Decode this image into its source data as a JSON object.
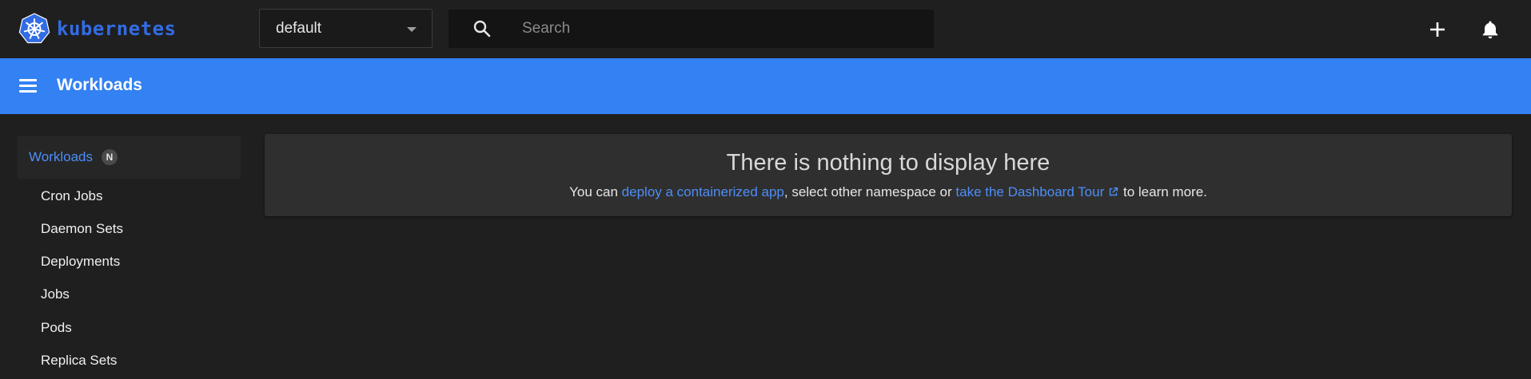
{
  "brand": {
    "name": "kubernetes",
    "color": "#326ce5"
  },
  "toolbar": {
    "namespace_selected": "default",
    "search_placeholder": "Search",
    "create_icon": "plus-icon",
    "notifications_icon": "bell-icon"
  },
  "header": {
    "title": "Workloads",
    "background": "#3381f2"
  },
  "sidebar": {
    "group": {
      "label": "Workloads",
      "badge": "N"
    },
    "items": [
      {
        "label": "Cron Jobs"
      },
      {
        "label": "Daemon Sets"
      },
      {
        "label": "Deployments"
      },
      {
        "label": "Jobs"
      },
      {
        "label": "Pods"
      },
      {
        "label": "Replica Sets"
      }
    ]
  },
  "main": {
    "empty_title": "There is nothing to display here",
    "text_prefix": "You can ",
    "link_deploy": "deploy a containerized app",
    "text_middle": ", select other namespace or ",
    "link_tour": "take the Dashboard Tour",
    "text_suffix": " to learn more."
  }
}
